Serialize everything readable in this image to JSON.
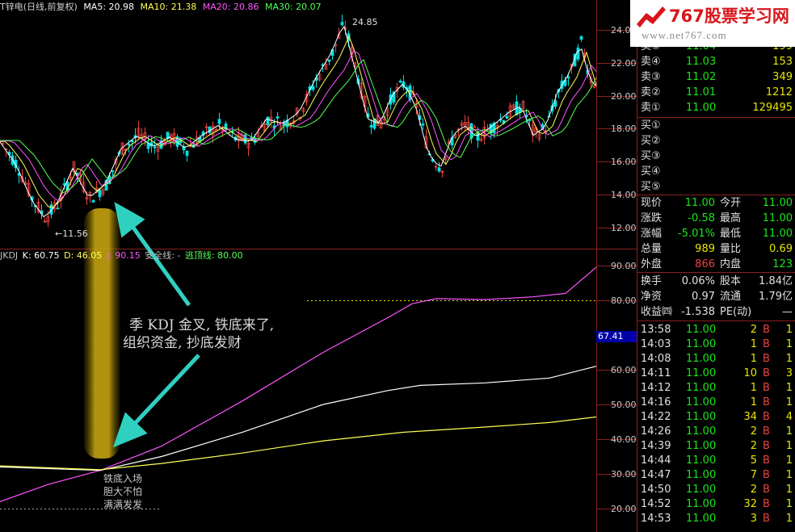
{
  "header": {
    "title": "T锌电(日线,前复权)",
    "ma5": "MA5: 20.98",
    "ma10": "MA10: 21.38",
    "ma20": "MA20: 20.86",
    "ma30": "MA30: 20.07"
  },
  "price_axis": [
    "24.00",
    "22.00",
    "20.00",
    "18.00",
    "16.00",
    "14.00",
    "12.00"
  ],
  "price_annotations": {
    "high": "24.85",
    "low": "11.56"
  },
  "kdj": {
    "title": "JKDJ",
    "k": "K: 60.75",
    "d": "D: 46.05",
    "j": "J: 90.15",
    "safe": "安全线: -",
    "escape": "逃顶线: 80.00"
  },
  "kdj_axis": [
    "90.00",
    "80.00",
    "60.00",
    "50.00",
    "40.00",
    "30.00",
    "20.00"
  ],
  "kdj_current": "67.41",
  "annotation": {
    "line1": "季 KDJ 金叉, 铁底来了,",
    "line2": "组织资金, 抄底发财",
    "small1": "铁底入场",
    "small2": "胆大不怕",
    "small3": "满满发发"
  },
  "logo": {
    "brand": "767股票学习网",
    "url": "www.net767.com"
  },
  "order_book": {
    "asks": [
      {
        "label": "卖⑤",
        "price": "11.04",
        "vol": "199"
      },
      {
        "label": "卖④",
        "price": "11.03",
        "vol": "153"
      },
      {
        "label": "卖③",
        "price": "11.02",
        "vol": "349"
      },
      {
        "label": "卖②",
        "price": "11.01",
        "vol": "1212"
      },
      {
        "label": "卖①",
        "price": "11.00",
        "vol": "129495"
      }
    ],
    "bids": [
      "买①",
      "买②",
      "买③",
      "买④",
      "买⑤"
    ]
  },
  "quote": [
    {
      "l1": "现价",
      "v1": "11.00",
      "l2": "今开",
      "v2": "11.00"
    },
    {
      "l1": "涨跌",
      "v1": "-0.58",
      "l2": "最高",
      "v2": "11.00"
    },
    {
      "l1": "涨幅",
      "v1": "-5.01%",
      "l2": "最低",
      "v2": "11.00"
    },
    {
      "l1": "总量",
      "v1": "989",
      "l2": "量比",
      "v2": "0.69"
    },
    {
      "l1": "外盘",
      "v1": "866",
      "l2": "内盘",
      "v2": "123"
    }
  ],
  "fundamentals": [
    {
      "l1": "换手",
      "v1": "0.06%",
      "l2": "股本",
      "v2": "1.84亿"
    },
    {
      "l1": "净资",
      "v1": "0.97",
      "l2": "流通",
      "v2": "1.79亿"
    },
    {
      "l1": "收益㈣",
      "v1": "-1.538",
      "l2": "PE(动)",
      "v2": "—"
    }
  ],
  "ticks": [
    {
      "time": "13:58",
      "price": "11.00",
      "vol": "2",
      "side": "B",
      "n": "1"
    },
    {
      "time": "14:03",
      "price": "11.00",
      "vol": "1",
      "side": "B",
      "n": "1"
    },
    {
      "time": "14:08",
      "price": "11.00",
      "vol": "1",
      "side": "B",
      "n": "1"
    },
    {
      "time": "14:11",
      "price": "11.00",
      "vol": "10",
      "side": "B",
      "n": "3"
    },
    {
      "time": "14:12",
      "price": "11.00",
      "vol": "1",
      "side": "B",
      "n": "1"
    },
    {
      "time": "14:16",
      "price": "11.00",
      "vol": "1",
      "side": "B",
      "n": "1"
    },
    {
      "time": "14:22",
      "price": "11.00",
      "vol": "34",
      "side": "B",
      "n": "4"
    },
    {
      "time": "14:26",
      "price": "11.00",
      "vol": "2",
      "side": "B",
      "n": "1"
    },
    {
      "time": "14:39",
      "price": "11.00",
      "vol": "2",
      "side": "B",
      "n": "1"
    },
    {
      "time": "14:44",
      "price": "11.00",
      "vol": "5",
      "side": "B",
      "n": "1"
    },
    {
      "time": "14:47",
      "price": "11.00",
      "vol": "7",
      "side": "B",
      "n": "1"
    },
    {
      "time": "14:50",
      "price": "11.00",
      "vol": "2",
      "side": "B",
      "n": "1"
    },
    {
      "time": "14:52",
      "price": "11.00",
      "vol": "32",
      "side": "B",
      "n": "1"
    },
    {
      "time": "14:53",
      "price": "11.00",
      "vol": "3",
      "side": "B",
      "n": "1"
    }
  ],
  "colors": {
    "up": "#e8433f",
    "down": "#00e0e0",
    "value_green": "#19e619",
    "value_yellow": "#e6e600",
    "ma_white": "#ffffff",
    "ma_yellow": "#ffff55",
    "ma_magenta": "#ff55ff",
    "ma_green": "#55ff55",
    "arrow": "#2fd0c0"
  }
}
